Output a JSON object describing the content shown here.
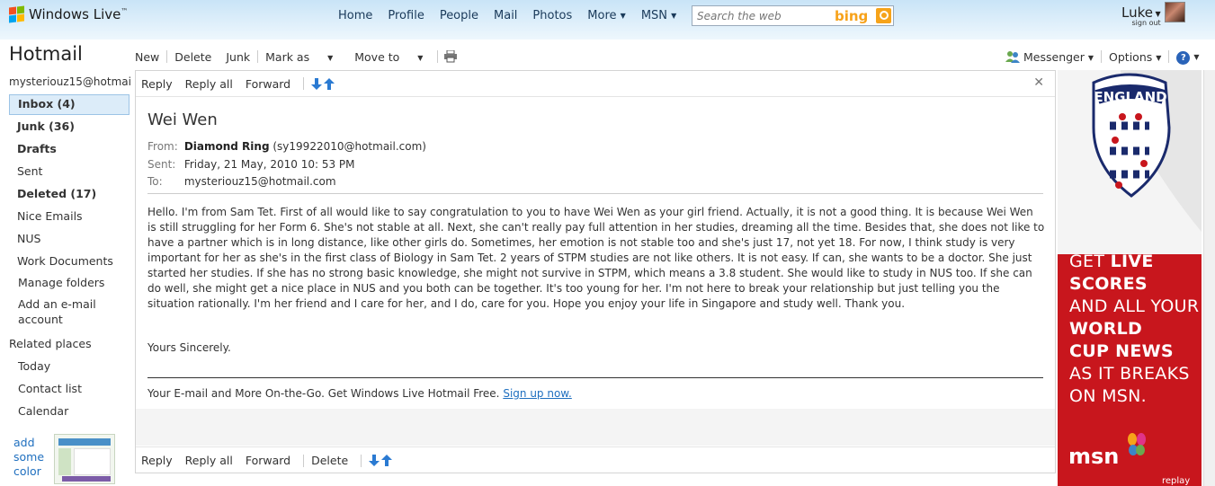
{
  "topbar": {
    "brand": "Windows Live",
    "brand_tm": "™",
    "nav": [
      "Home",
      "Profile",
      "People",
      "Mail",
      "Photos"
    ],
    "more": "More",
    "msn": "MSN",
    "search_placeholder": "Search the web",
    "bing": "bing",
    "user_name": "Luke",
    "sign_out": "sign out"
  },
  "sidebar": {
    "title": "Hotmail",
    "account": "mysteriouz15@hotmail.",
    "folders": [
      {
        "label": "Inbox (4)"
      },
      {
        "label": "Junk (36)"
      },
      {
        "label": "Drafts"
      },
      {
        "label": "Sent"
      },
      {
        "label": "Deleted (17)"
      },
      {
        "label": "Nice Emails"
      },
      {
        "label": "NUS"
      },
      {
        "label": "Work Documents"
      }
    ],
    "manage_folders": "Manage folders",
    "add_account": "Add an e-mail account",
    "related_title": "Related places",
    "related": [
      "Today",
      "Contact list",
      "Calendar"
    ],
    "promo": "add some color"
  },
  "toolbar": {
    "new": "New",
    "delete": "Delete",
    "junk": "Junk",
    "mark_as": "Mark as",
    "move_to": "Move to",
    "messenger": "Messenger",
    "options": "Options"
  },
  "message": {
    "reply": "Reply",
    "reply_all": "Reply all",
    "forward": "Forward",
    "delete": "Delete",
    "subject": "Wei Wen",
    "from_label": "From:",
    "from_name": "Diamond Ring",
    "from_email": "(sy19922010@hotmail.com)",
    "sent_label": "Sent:",
    "sent": "Friday, 21 May, 2010 10: 53 PM",
    "to_label": "To:",
    "to": "mysteriouz15@hotmail.com",
    "body": "Hello. I'm from Sam Tet. First of all would like to say congratulation to you to have Wei Wen as your girl friend. Actually, it is not a good thing. It is because Wei Wen is still struggling for her Form 6. She's not stable at all. Next, she can't really pay full attention in her studies, dreaming all the time. Besides that, she does not like to have a partner which is in long distance, like other girls do. Sometimes, her emotion is not stable too and she's just 17, not yet 18. For now, I think study is very important for her as she's in the first class of Biology in Sam Tet. 2 years of STPM studies are not like others. It is not easy. If can, she wants to be a doctor. She just started her studies. If she has no strong basic knowledge, she might not survive in STPM, which means a 3.8 student. She would like to study in NUS too. If she can do well, she might get a nice place in NUS and you both can be together. It's too young for her. I'm not here to break your relationship but just telling you the situation rationally. I'm her friend and I care for her, and I do, care for you. Hope you enjoy your life in Singapore and study well. Thank you.",
    "signoff": "Yours Sincerely.",
    "footer": "Your E-mail and More On-the-Go. Get Windows Live Hotmail Free.",
    "footer_link": "Sign up now."
  },
  "ad": {
    "shirt_text": "ENGLAND",
    "line1a": "GET ",
    "line1b": "LIVE",
    "line2": "SCORES",
    "line3": "AND ALL YOUR",
    "line4": "WORLD",
    "line5": "CUP NEWS",
    "line6": "AS IT BREAKS",
    "line7": "ON MSN.",
    "logo": "msn",
    "replay": "replay"
  }
}
